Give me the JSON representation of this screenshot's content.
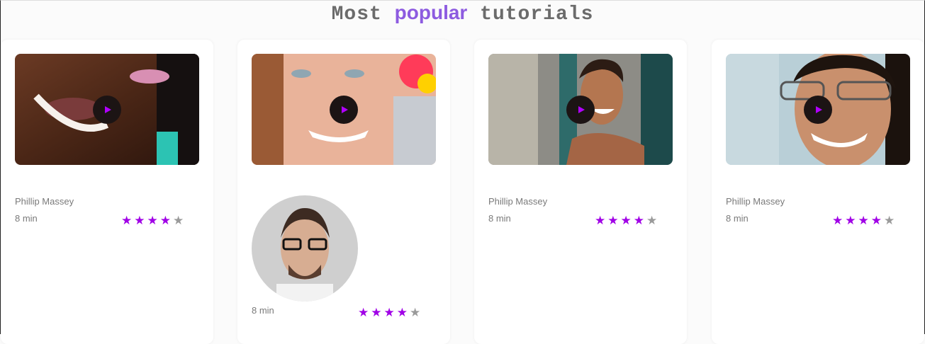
{
  "heading": {
    "prefix": "Most",
    "accent": "popular",
    "suffix": "tutorials"
  },
  "cards": [
    {
      "author": "Phillip Massey",
      "duration": "8 min",
      "rating": 4,
      "max_rating": 5
    },
    {
      "author": "",
      "duration": "8 min",
      "rating": 4,
      "max_rating": 5
    },
    {
      "author": "Phillip Massey",
      "duration": "8 min",
      "rating": 4,
      "max_rating": 5
    },
    {
      "author": "Phillip Massey",
      "duration": "8 min",
      "rating": 4,
      "max_rating": 5
    }
  ],
  "icons": {
    "play": "play-icon",
    "star": "star-icon"
  },
  "colors": {
    "accent": "#8d5be0",
    "star_active": "#a000e6",
    "star_inactive": "#9a9a9a",
    "play_bg": "#1c1414"
  }
}
